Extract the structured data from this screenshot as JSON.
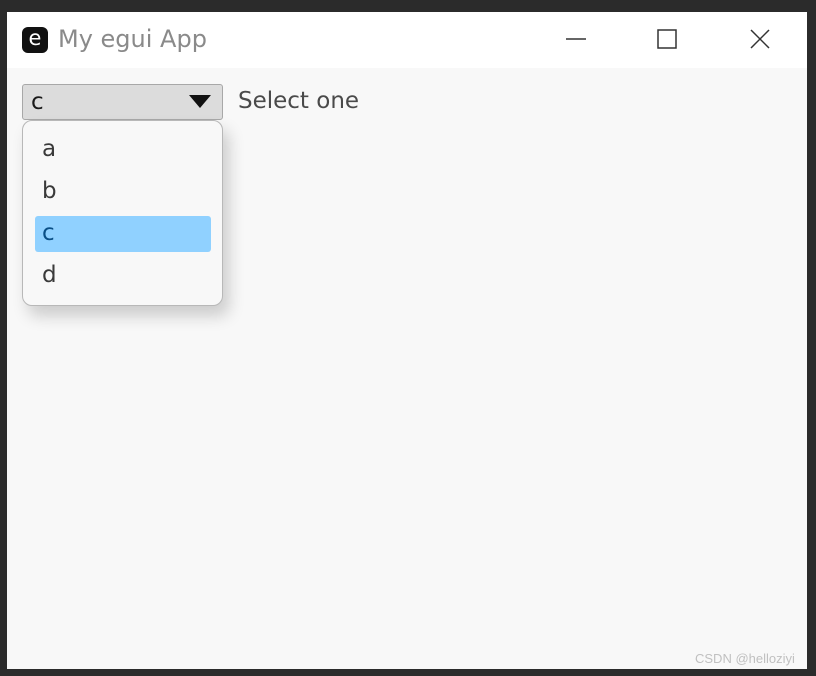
{
  "window": {
    "title": "My egui App",
    "icon_letter": "e",
    "controls": [
      "minimize-icon",
      "maximize-icon",
      "close-icon"
    ]
  },
  "combo": {
    "selected": "c",
    "label": "Select one",
    "arrow_icon": "triangle-down-icon",
    "options": [
      "a",
      "b",
      "c",
      "d"
    ],
    "selected_index": 2
  },
  "colors": {
    "selection": "#90d1ff",
    "panel_bg": "#f8f8f8"
  },
  "watermark": "CSDN @helloziyi"
}
